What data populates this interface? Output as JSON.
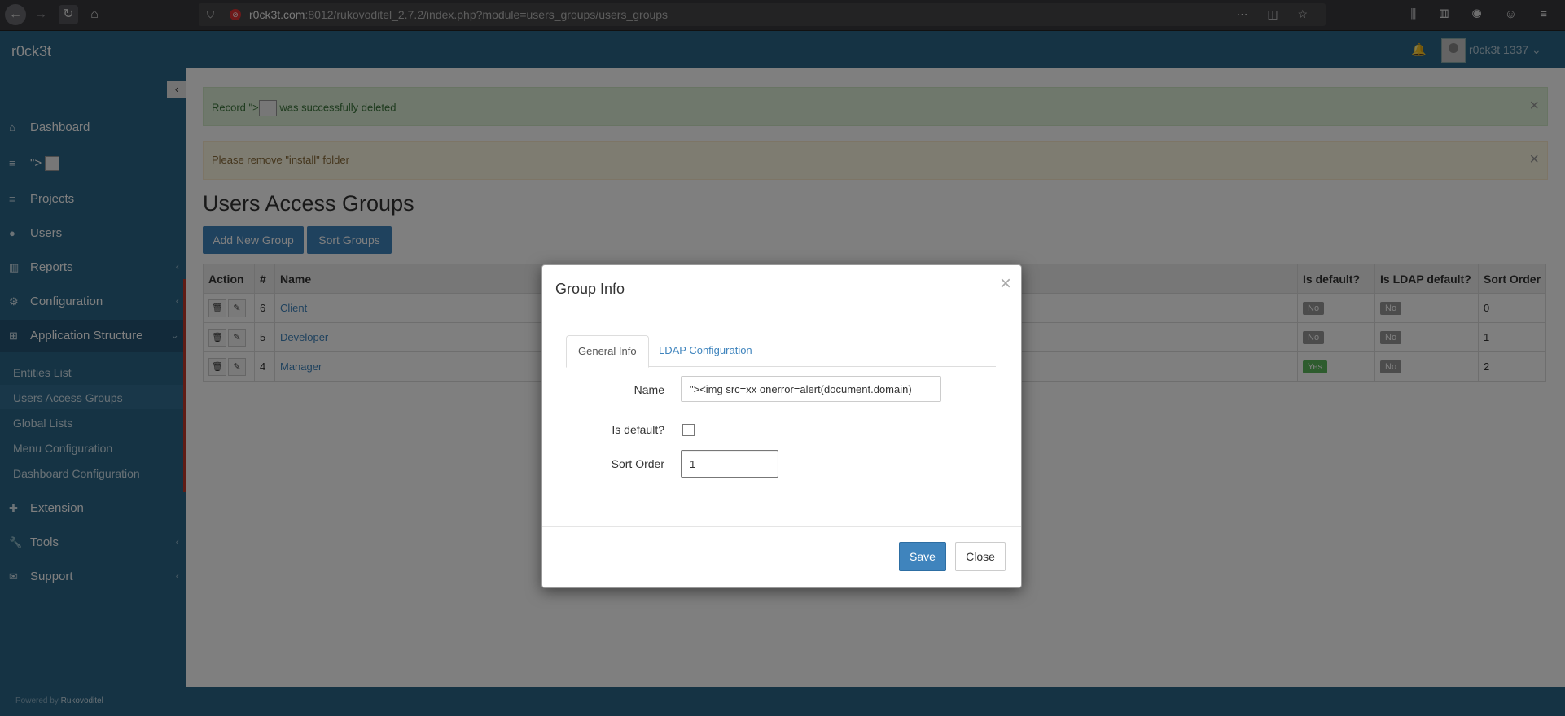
{
  "browser": {
    "url_host": "r0ck3t.com",
    "url_rest": ":8012/rukovoditel_2.7.2/index.php?module=users_groups/users_groups"
  },
  "header": {
    "brand": "r0ck3t",
    "username": "r0ck3t 1337"
  },
  "sidebar": {
    "items": [
      {
        "label": "Dashboard",
        "icon": "home-icon"
      },
      {
        "label": "\">",
        "icon": "menu-icon"
      },
      {
        "label": "Projects",
        "icon": "list-icon"
      },
      {
        "label": "Users",
        "icon": "user-icon"
      },
      {
        "label": "Reports",
        "icon": "bar-chart-icon"
      },
      {
        "label": "Configuration",
        "icon": "gear-icon"
      },
      {
        "label": "Application Structure",
        "icon": "sitemap-icon"
      },
      {
        "label": "Extension",
        "icon": "puzzle-icon"
      },
      {
        "label": "Tools",
        "icon": "wrench-icon"
      },
      {
        "label": "Support",
        "icon": "envelope-icon"
      }
    ],
    "sub_items": [
      "Entities List",
      "Users Access Groups",
      "Global Lists",
      "Menu Configuration",
      "Dashboard Configuration"
    ]
  },
  "alerts": {
    "success_prefix": "Record \">",
    "success_suffix": "was successfully deleted",
    "warning": "Please remove \"install\" folder"
  },
  "page": {
    "title": "Users Access Groups",
    "add_button": "Add New Group",
    "sort_button": "Sort Groups"
  },
  "table": {
    "headers": [
      "Action",
      "#",
      "Name",
      "Is default?",
      "Is LDAP default?",
      "Sort Order"
    ],
    "rows": [
      {
        "id": "6",
        "name": "Client",
        "is_default": "No",
        "is_ldap_default": "No",
        "sort_order": "0"
      },
      {
        "id": "5",
        "name": "Developer",
        "is_default": "No",
        "is_ldap_default": "No",
        "sort_order": "1"
      },
      {
        "id": "4",
        "name": "Manager",
        "is_default": "Yes",
        "is_ldap_default": "No",
        "sort_order": "2"
      }
    ]
  },
  "modal": {
    "title": "Group Info",
    "tabs": [
      "General Info",
      "LDAP Configuration"
    ],
    "name_label": "Name",
    "name_value": "\"><img src=xx onerror=alert(document.domain)",
    "is_default_label": "Is default?",
    "sort_order_label": "Sort Order",
    "sort_order_value": "1",
    "save": "Save",
    "close": "Close"
  },
  "footer": {
    "powered_prefix": "Powered by",
    "powered_brand": "Rukovoditel"
  }
}
